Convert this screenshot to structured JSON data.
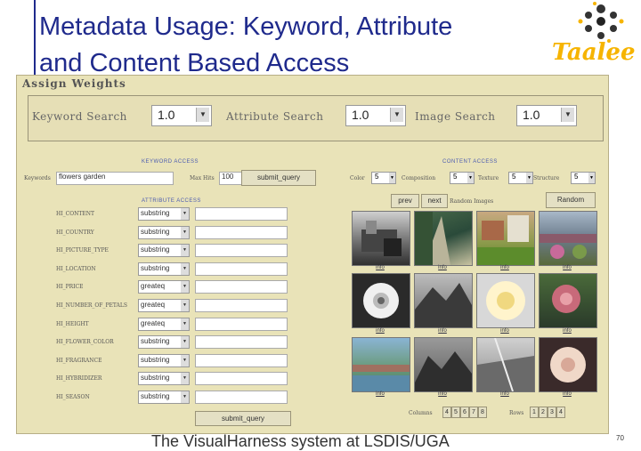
{
  "slide": {
    "title_line1": "Metadata Usage: Keyword, Attribute",
    "title_line2": "and Content Based Access",
    "logo_text": "Taalee",
    "footer": "The VisualHarness system at LSDIS/UGA",
    "page_number": "70",
    "title_color": "#1f2a8c",
    "logo_color": "#f6b400"
  },
  "app": {
    "assign_title": "Assign Weights",
    "weights": [
      {
        "label": "Keyword Search",
        "value": "1.0"
      },
      {
        "label": "Attribute Search",
        "value": "1.0"
      },
      {
        "label": "Image Search",
        "value": "1.0"
      }
    ],
    "keyword_access": {
      "header": "KEYWORD ACCESS",
      "keywords_label": "Keywords",
      "keywords_value": "flowers garden",
      "max_hits_label": "Max Hits",
      "max_hits_value": "100",
      "submit_label": "submit_query"
    },
    "attribute_access": {
      "header": "ATTRIBUTE ACCESS",
      "rows": [
        {
          "label": "HI_CONTENT",
          "op": "substring"
        },
        {
          "label": "HI_COUNTRY",
          "op": "substring"
        },
        {
          "label": "HI_PICTURE_TYPE",
          "op": "substring"
        },
        {
          "label": "HI_LOCATION",
          "op": "substring"
        },
        {
          "label": "HI_PRICE",
          "op": "greateq"
        },
        {
          "label": "HI_NUMBER_OF_PETALS",
          "op": "greateq"
        },
        {
          "label": "HI_HEIGHT",
          "op": "greateq"
        },
        {
          "label": "HI_FLOWER_COLOR",
          "op": "substring"
        },
        {
          "label": "HI_FRAGRANCE",
          "op": "substring"
        },
        {
          "label": "HI_HYBRIDIZER",
          "op": "substring"
        },
        {
          "label": "HI_SEASON",
          "op": "substring"
        }
      ],
      "submit_label": "submit_query"
    },
    "content_access": {
      "header": "CONTENT ACCESS",
      "controls": [
        {
          "label": "Color",
          "value": "5"
        },
        {
          "label": "Composition",
          "value": "5"
        },
        {
          "label": "Texture",
          "value": "5"
        },
        {
          "label": "Structure",
          "value": "5"
        }
      ],
      "prev_label": "prev",
      "next_label": "next",
      "random_images_label": "Random Images",
      "random_button": "Random",
      "info_label": "info",
      "columns_label": "Columns",
      "columns": [
        "4",
        "5",
        "6",
        "7",
        "8"
      ],
      "rows_label": "Rows",
      "rows": [
        "1",
        "2",
        "3",
        "4"
      ]
    }
  }
}
